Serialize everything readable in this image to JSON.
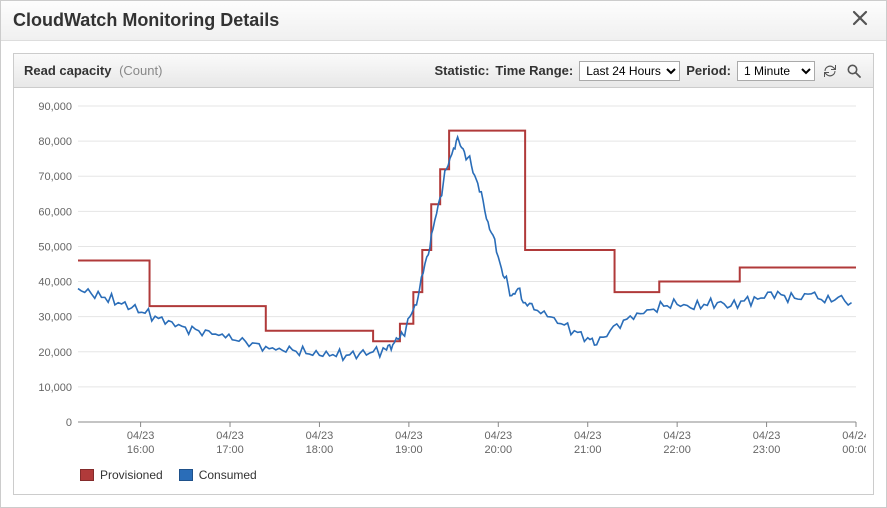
{
  "dialog": {
    "title": "CloudWatch Monitoring Details"
  },
  "panel": {
    "metric_name": "Read capacity",
    "metric_unit": "(Count)",
    "statistic_label": "Statistic:",
    "timerange_label": "Time Range:",
    "timerange_value": "Last 24 Hours",
    "period_label": "Period:",
    "period_value": "1 Minute"
  },
  "legend": {
    "provisioned": "Provisioned",
    "consumed": "Consumed"
  },
  "colors": {
    "provisioned": "#b03a3a",
    "consumed": "#2a6db8"
  },
  "chart_data": {
    "type": "line",
    "title": "Read capacity (Count)",
    "xlabel": "",
    "ylabel": "",
    "ylim": [
      0,
      90000
    ],
    "yticks": [
      0,
      10000,
      20000,
      30000,
      40000,
      50000,
      60000,
      70000,
      80000,
      90000
    ],
    "x_tick_labels": [
      {
        "x": 16.0,
        "top": "04/23",
        "bottom": "16:00"
      },
      {
        "x": 17.0,
        "top": "04/23",
        "bottom": "17:00"
      },
      {
        "x": 18.0,
        "top": "04/23",
        "bottom": "18:00"
      },
      {
        "x": 19.0,
        "top": "04/23",
        "bottom": "19:00"
      },
      {
        "x": 20.0,
        "top": "04/23",
        "bottom": "20:00"
      },
      {
        "x": 21.0,
        "top": "04/23",
        "bottom": "21:00"
      },
      {
        "x": 22.0,
        "top": "04/23",
        "bottom": "22:00"
      },
      {
        "x": 23.0,
        "top": "04/23",
        "bottom": "23:00"
      },
      {
        "x": 24.0,
        "top": "04/24",
        "bottom": "00:00"
      }
    ],
    "x_range": [
      15.3,
      24.0
    ],
    "series": [
      {
        "name": "Provisioned",
        "style": "step",
        "values": [
          {
            "x": 15.3,
            "y": 46000
          },
          {
            "x": 16.1,
            "y": 46000
          },
          {
            "x": 16.1,
            "y": 33000
          },
          {
            "x": 17.4,
            "y": 33000
          },
          {
            "x": 17.4,
            "y": 26000
          },
          {
            "x": 18.6,
            "y": 26000
          },
          {
            "x": 18.6,
            "y": 23000
          },
          {
            "x": 18.9,
            "y": 23000
          },
          {
            "x": 18.9,
            "y": 28000
          },
          {
            "x": 19.05,
            "y": 28000
          },
          {
            "x": 19.05,
            "y": 37000
          },
          {
            "x": 19.15,
            "y": 37000
          },
          {
            "x": 19.15,
            "y": 49000
          },
          {
            "x": 19.25,
            "y": 49000
          },
          {
            "x": 19.25,
            "y": 62000
          },
          {
            "x": 19.35,
            "y": 62000
          },
          {
            "x": 19.35,
            "y": 72000
          },
          {
            "x": 19.45,
            "y": 72000
          },
          {
            "x": 19.45,
            "y": 83000
          },
          {
            "x": 20.3,
            "y": 83000
          },
          {
            "x": 20.3,
            "y": 49000
          },
          {
            "x": 21.3,
            "y": 49000
          },
          {
            "x": 21.3,
            "y": 37000
          },
          {
            "x": 21.8,
            "y": 37000
          },
          {
            "x": 21.8,
            "y": 40000
          },
          {
            "x": 22.7,
            "y": 40000
          },
          {
            "x": 22.7,
            "y": 44000
          },
          {
            "x": 24.0,
            "y": 44000
          }
        ]
      },
      {
        "name": "Consumed",
        "style": "line",
        "values": [
          {
            "x": 15.3,
            "y": 38000
          },
          {
            "x": 15.45,
            "y": 36500
          },
          {
            "x": 15.6,
            "y": 35500
          },
          {
            "x": 15.75,
            "y": 34000
          },
          {
            "x": 15.9,
            "y": 32500
          },
          {
            "x": 16.05,
            "y": 31000
          },
          {
            "x": 16.2,
            "y": 29500
          },
          {
            "x": 16.35,
            "y": 28500
          },
          {
            "x": 16.5,
            "y": 27000
          },
          {
            "x": 16.65,
            "y": 26000
          },
          {
            "x": 16.8,
            "y": 25000
          },
          {
            "x": 16.95,
            "y": 24000
          },
          {
            "x": 17.1,
            "y": 23000
          },
          {
            "x": 17.25,
            "y": 22500
          },
          {
            "x": 17.4,
            "y": 21500
          },
          {
            "x": 17.55,
            "y": 21000
          },
          {
            "x": 17.7,
            "y": 20500
          },
          {
            "x": 17.85,
            "y": 19500
          },
          {
            "x": 18.0,
            "y": 19000
          },
          {
            "x": 18.15,
            "y": 19200
          },
          {
            "x": 18.3,
            "y": 19000
          },
          {
            "x": 18.45,
            "y": 19500
          },
          {
            "x": 18.6,
            "y": 20000
          },
          {
            "x": 18.75,
            "y": 20500
          },
          {
            "x": 18.82,
            "y": 22000
          },
          {
            "x": 18.9,
            "y": 24000
          },
          {
            "x": 18.97,
            "y": 27000
          },
          {
            "x": 19.05,
            "y": 32000
          },
          {
            "x": 19.12,
            "y": 38000
          },
          {
            "x": 19.2,
            "y": 47000
          },
          {
            "x": 19.27,
            "y": 55000
          },
          {
            "x": 19.35,
            "y": 64000
          },
          {
            "x": 19.42,
            "y": 72000
          },
          {
            "x": 19.5,
            "y": 78000
          },
          {
            "x": 19.56,
            "y": 80000
          },
          {
            "x": 19.62,
            "y": 77000
          },
          {
            "x": 19.7,
            "y": 73000
          },
          {
            "x": 19.77,
            "y": 68000
          },
          {
            "x": 19.85,
            "y": 60000
          },
          {
            "x": 19.92,
            "y": 54000
          },
          {
            "x": 20.0,
            "y": 47000
          },
          {
            "x": 20.07,
            "y": 41000
          },
          {
            "x": 20.15,
            "y": 36000
          },
          {
            "x": 20.22,
            "y": 38000
          },
          {
            "x": 20.3,
            "y": 34000
          },
          {
            "x": 20.4,
            "y": 32000
          },
          {
            "x": 20.55,
            "y": 30000
          },
          {
            "x": 20.7,
            "y": 28000
          },
          {
            "x": 20.85,
            "y": 26000
          },
          {
            "x": 21.0,
            "y": 24000
          },
          {
            "x": 21.1,
            "y": 22000
          },
          {
            "x": 21.25,
            "y": 26000
          },
          {
            "x": 21.4,
            "y": 29000
          },
          {
            "x": 21.55,
            "y": 31000
          },
          {
            "x": 21.7,
            "y": 32000
          },
          {
            "x": 21.85,
            "y": 33000
          },
          {
            "x": 22.0,
            "y": 33500
          },
          {
            "x": 22.15,
            "y": 32500
          },
          {
            "x": 22.3,
            "y": 33500
          },
          {
            "x": 22.45,
            "y": 34000
          },
          {
            "x": 22.6,
            "y": 33000
          },
          {
            "x": 22.75,
            "y": 34500
          },
          {
            "x": 22.9,
            "y": 35000
          },
          {
            "x": 23.05,
            "y": 37000
          },
          {
            "x": 23.2,
            "y": 36000
          },
          {
            "x": 23.35,
            "y": 35000
          },
          {
            "x": 23.5,
            "y": 36500
          },
          {
            "x": 23.65,
            "y": 34000
          },
          {
            "x": 23.8,
            "y": 35500
          },
          {
            "x": 23.95,
            "y": 34000
          }
        ]
      }
    ]
  }
}
